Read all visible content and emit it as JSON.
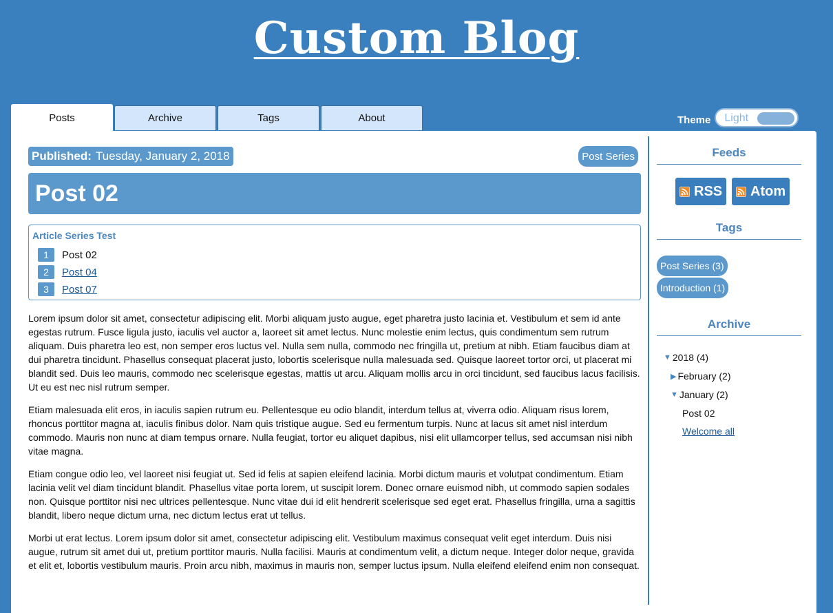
{
  "site": {
    "title": "Custom Blog"
  },
  "tabs": [
    {
      "label": "Posts",
      "active": true
    },
    {
      "label": "Archive",
      "active": false
    },
    {
      "label": "Tags",
      "active": false
    },
    {
      "label": "About",
      "active": false
    }
  ],
  "theme": {
    "label": "Theme",
    "value": "Light"
  },
  "post": {
    "published_label": "Published:",
    "published_date": "Tuesday, January 2, 2018",
    "series_tag": "Post Series",
    "title": "Post 02",
    "series": {
      "title": "Article Series Test",
      "items": [
        {
          "num": "1",
          "label": "Post 02",
          "link": false
        },
        {
          "num": "2",
          "label": "Post 04",
          "link": true
        },
        {
          "num": "3",
          "label": "Post 07",
          "link": true
        }
      ]
    },
    "paragraphs": [
      "Lorem ipsum dolor sit amet, consectetur adipiscing elit. Morbi aliquam justo augue, eget pharetra justo lacinia et. Vestibulum et sem id ante egestas rutrum. Fusce ligula justo, iaculis vel auctor a, laoreet sit amet lectus. Nunc molestie enim lectus, quis condimentum sem rutrum aliquam. Duis pharetra leo est, non semper eros luctus vel. Nulla sem nulla, commodo nec fringilla ut, pretium at nibh. Etiam faucibus diam at dui pharetra tincidunt. Phasellus consequat placerat justo, lobortis scelerisque nulla malesuada sed. Quisque laoreet tortor orci, ut placerat mi blandit sed. Duis leo mauris, commodo nec scelerisque egestas, mattis ut arcu. Aliquam mollis arcu in orci tincidunt, sed faucibus lacus facilisis. Ut eu est nec nisl rutrum semper.",
      "Etiam malesuada elit eros, in iaculis sapien rutrum eu. Pellentesque eu odio blandit, interdum tellus at, viverra odio. Aliquam risus lorem, rhoncus porttitor magna at, iaculis finibus dolor. Nam quis tristique augue. Sed eu fermentum turpis. Nunc at lacus sit amet nisl interdum commodo. Mauris non nunc at diam tempus ornare. Nulla feugiat, tortor eu aliquet dapibus, nisi elit ullamcorper tellus, sed accumsan nisi nibh vitae magna.",
      "Etiam congue odio leo, vel laoreet nisi feugiat ut. Sed id felis at sapien eleifend lacinia. Morbi dictum mauris et volutpat condimentum. Etiam lacinia velit vel diam tincidunt blandit. Phasellus vitae porta lorem, ut suscipit lorem. Donec ornare euismod nibh, ut commodo sapien sodales non. Quisque porttitor nisi nec ultrices pellentesque. Nunc vitae dui id elit hendrerit scelerisque sed eget erat. Phasellus fringilla, urna a sagittis blandit, libero neque dictum urna, nec dictum lectus erat ut tellus.",
      "Morbi ut erat lectus. Lorem ipsum dolor sit amet, consectetur adipiscing elit. Vestibulum maximus consequat velit eget interdum. Duis nisi augue, rutrum sit amet dui ut, pretium porttitor mauris. Nulla facilisi. Mauris at condimentum velit, a dictum neque. Integer dolor neque, gravida et elit et, lobortis vestibulum mauris. Proin arcu nibh, maximus in mauris non, semper luctus ipsum. Nulla eleifend eleifend enim non consequat."
    ]
  },
  "sidebar": {
    "feeds_title": "Feeds",
    "feeds": [
      {
        "label": "RSS",
        "icon": "rss-icon"
      },
      {
        "label": "Atom",
        "icon": "rss-icon"
      }
    ],
    "tags_title": "Tags",
    "tags": [
      {
        "label": "Post Series (3)"
      },
      {
        "label": "Introduction (1)"
      }
    ],
    "archive_title": "Archive",
    "archive": {
      "year": "2018 (4)",
      "february": "February (2)",
      "january": "January (2)",
      "posts": [
        {
          "label": "Post 02",
          "link": false
        },
        {
          "label": "Welcome all",
          "link": true
        }
      ]
    }
  },
  "colors": {
    "background": "#3a80bf",
    "accent": "#5b98cc",
    "tab_inactive": "#d3e6fb"
  }
}
